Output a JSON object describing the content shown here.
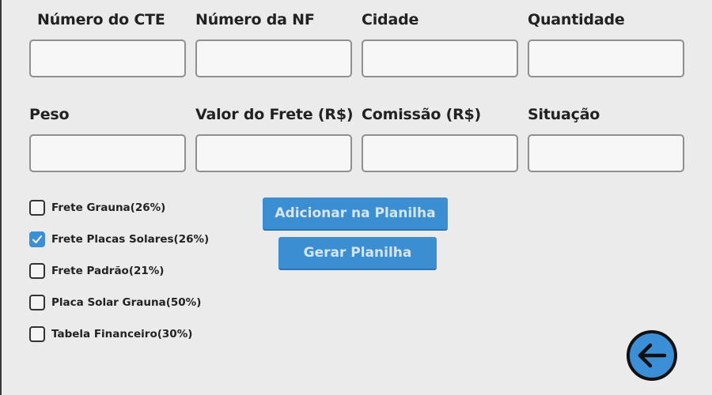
{
  "fields_row1": [
    {
      "label": "Número do CTE",
      "value": "",
      "placeholder": ""
    },
    {
      "label": "Número da NF",
      "value": "",
      "placeholder": ""
    },
    {
      "label": "Cidade",
      "value": "",
      "placeholder": ""
    },
    {
      "label": "Quantidade",
      "value": "",
      "placeholder": ""
    }
  ],
  "fields_row2": [
    {
      "label": "Peso",
      "value": "",
      "placeholder": ""
    },
    {
      "label": "Valor do Frete (R$)",
      "value": "",
      "placeholder": ""
    },
    {
      "label": "Comissão (R$)",
      "value": "",
      "placeholder": ""
    },
    {
      "label": "Situação",
      "value": "",
      "placeholder": ""
    }
  ],
  "checkboxes": [
    {
      "label": "Frete Grauna(26%)",
      "checked": false
    },
    {
      "label": "Frete Placas Solares(26%)",
      "checked": true
    },
    {
      "label": "Frete Padrão(21%)",
      "checked": false
    },
    {
      "label": "Placa Solar Grauna(50%)",
      "checked": false
    },
    {
      "label": "Tabela Financeiro(30%)",
      "checked": false
    }
  ],
  "buttons": {
    "add_label": "Adicionar na Planilha",
    "generate_label": "Gerar Planilha"
  },
  "icons": {
    "back": "arrow-left-circle-icon",
    "check": "checkmark-icon"
  },
  "colors": {
    "accent": "#3c8ed3",
    "background": "#ebebeb",
    "back_button_fill": "#3a8fd6"
  }
}
